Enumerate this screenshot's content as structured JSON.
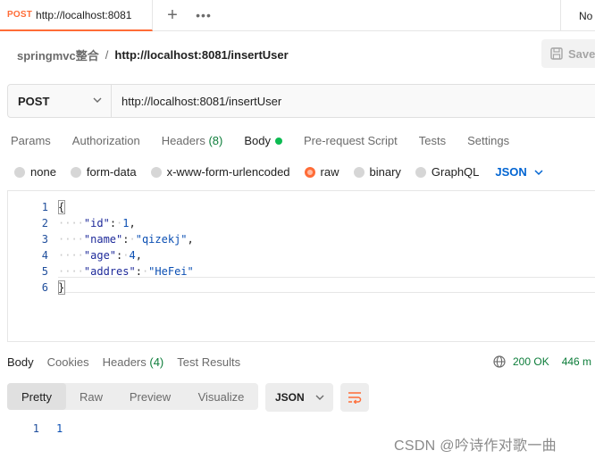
{
  "tabbar": {
    "tab_method": "POST",
    "tab_title": "http://localhost:8081",
    "plus_icon": "plus-icon",
    "more_icon": "more-icon",
    "environment": "No"
  },
  "breadcrumb": {
    "collection": "springmvc整合",
    "separator": "/",
    "request": "http://localhost:8081/insertUser",
    "save_label": "Save"
  },
  "request": {
    "method": "POST",
    "url": "http://localhost:8081/insertUser"
  },
  "request_tabs": [
    {
      "label": "Params"
    },
    {
      "label": "Authorization"
    },
    {
      "label": "Headers",
      "count": "(8)"
    },
    {
      "label": "Body",
      "active": true
    },
    {
      "label": "Pre-request Script"
    },
    {
      "label": "Tests"
    },
    {
      "label": "Settings"
    }
  ],
  "body_types": [
    {
      "label": "none"
    },
    {
      "label": "form-data"
    },
    {
      "label": "x-www-form-urlencoded"
    },
    {
      "label": "raw",
      "selected": true
    },
    {
      "label": "binary"
    },
    {
      "label": "GraphQL"
    }
  ],
  "body_language": "JSON",
  "editor": {
    "line_numbers": [
      "1",
      "2",
      "3",
      "4",
      "5",
      "6"
    ],
    "lines": [
      {
        "open": "{"
      },
      {
        "key": "\"id\"",
        "colon": ":",
        "value": "1",
        "trail": ","
      },
      {
        "key": "\"name\"",
        "colon": ":",
        "value": "\"qizekj\"",
        "trail": ","
      },
      {
        "key": "\"age\"",
        "colon": ":",
        "value": "4",
        "trail": ","
      },
      {
        "key": "\"addres\"",
        "colon": ":",
        "value": "\"HeFei\"",
        "trail": ""
      },
      {
        "close": "}"
      }
    ]
  },
  "response": {
    "tabs": [
      {
        "label": "Body",
        "active": true
      },
      {
        "label": "Cookies"
      },
      {
        "label": "Headers",
        "count": "(4)"
      },
      {
        "label": "Test Results"
      }
    ],
    "status_icon": "globe-icon",
    "status": "200 OK",
    "time": "446 m",
    "views": [
      "Pretty",
      "Raw",
      "Preview",
      "Visualize"
    ],
    "active_view": "Pretty",
    "format": "JSON",
    "wrap_icon": "wrap-lines-icon",
    "line_number": "1",
    "value": "1"
  },
  "watermark": "CSDN @吟诗作对歌一曲",
  "colors": {
    "accent": "#ff6c37",
    "link": "#0265d2",
    "success": "#0d7d3a",
    "dot": "#0cbb52"
  }
}
